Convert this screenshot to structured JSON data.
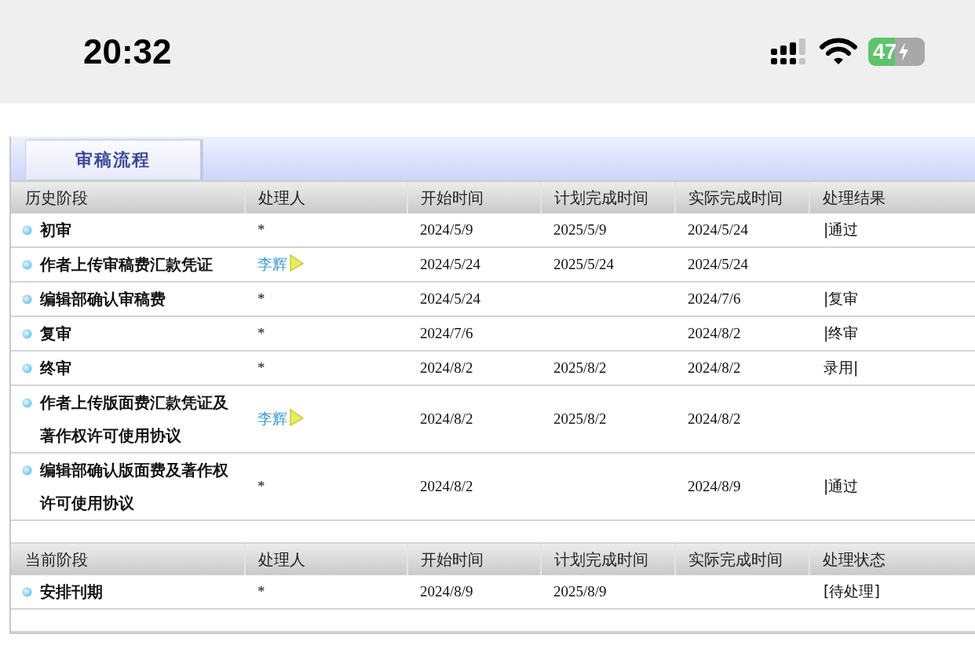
{
  "status_bar": {
    "time": "20:32",
    "battery": "47"
  },
  "tab": {
    "label": "审稿流程",
    "selected": true
  },
  "sections": [
    {
      "headers": [
        "历史阶段",
        "处理人",
        "开始时间",
        "计划完成时间",
        "实际完成时间",
        "处理结果"
      ],
      "rows": [
        {
          "stage": "初审",
          "handler": {
            "name": "*",
            "link": false
          },
          "start": "2024/5/9",
          "planned": "2025/5/9",
          "actual": "2024/5/24",
          "result": "|通过"
        },
        {
          "stage": "作者上传审稿费汇款凭证",
          "handler": {
            "name": "李辉",
            "link": true
          },
          "start": "2024/5/24",
          "planned": "2025/5/24",
          "actual": "2024/5/24"
        },
        {
          "stage": "编辑部确认审稿费",
          "handler": {
            "name": "*",
            "link": false
          },
          "start": "2024/5/24",
          "actual": "2024/7/6",
          "result": "|复审"
        },
        {
          "stage": "复审",
          "handler": {
            "name": "*",
            "link": false
          },
          "start": "2024/7/6",
          "actual": "2024/8/2",
          "result": "|终审"
        },
        {
          "stage": "终审",
          "handler": {
            "name": "*",
            "link": false
          },
          "start": "2024/8/2",
          "planned": "2025/8/2",
          "actual": "2024/8/2",
          "result": "录用|"
        },
        {
          "stage": "作者上传版面费汇款凭证及著作权许可使用协议",
          "handler": {
            "name": "李辉",
            "link": true
          },
          "start": "2024/8/2",
          "planned": "2025/8/2",
          "actual": "2024/8/2"
        },
        {
          "stage": "编辑部确认版面费及著作权许可使用协议",
          "handler": {
            "name": "*",
            "link": false
          },
          "start": "2024/8/2",
          "actual": "2024/8/9",
          "result": "|通过"
        }
      ]
    },
    {
      "headers": [
        "当前阶段",
        "处理人",
        "开始时间",
        "计划完成时间",
        "实际完成时间",
        "处理状态"
      ],
      "rows": [
        {
          "stage": "安排刊期",
          "handler": {
            "name": "*",
            "link": false
          },
          "start": "2024/8/9",
          "planned": "2025/8/9",
          "result": "[待处理]"
        }
      ]
    }
  ]
}
